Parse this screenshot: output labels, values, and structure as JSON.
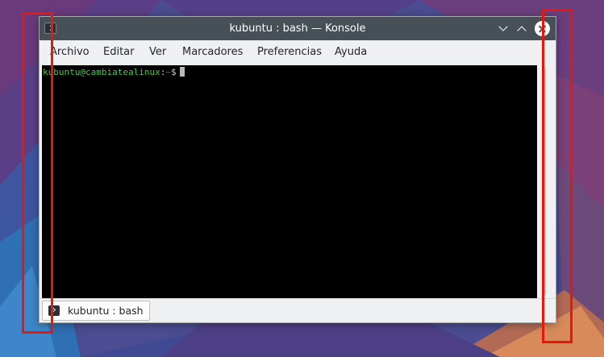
{
  "window": {
    "title": "kubuntu : bash — Konsole",
    "app_icon": "konsole-terminal-icon",
    "controls": {
      "minimize_icon": "chevron-down-icon",
      "maximize_icon": "chevron-up-icon",
      "close_icon": "close-icon"
    }
  },
  "menubar": {
    "items": [
      "Archivo",
      "Editar",
      "Ver",
      "Marcadores",
      "Preferencias",
      "Ayuda"
    ]
  },
  "terminal": {
    "prompt_user_host": "kubuntu@cambiatealinux",
    "prompt_separator": ":",
    "prompt_path": "~",
    "prompt_symbol": "$",
    "background": "#000000",
    "user_color": "#4fc34d",
    "path_color": "#3e7fd9"
  },
  "tabs": [
    {
      "label": "kubuntu : bash",
      "icon": "terminal-icon"
    }
  ],
  "colors": {
    "titlebar": "#475057",
    "window_background": "#eff0f1",
    "annotation": "#e8170c"
  }
}
